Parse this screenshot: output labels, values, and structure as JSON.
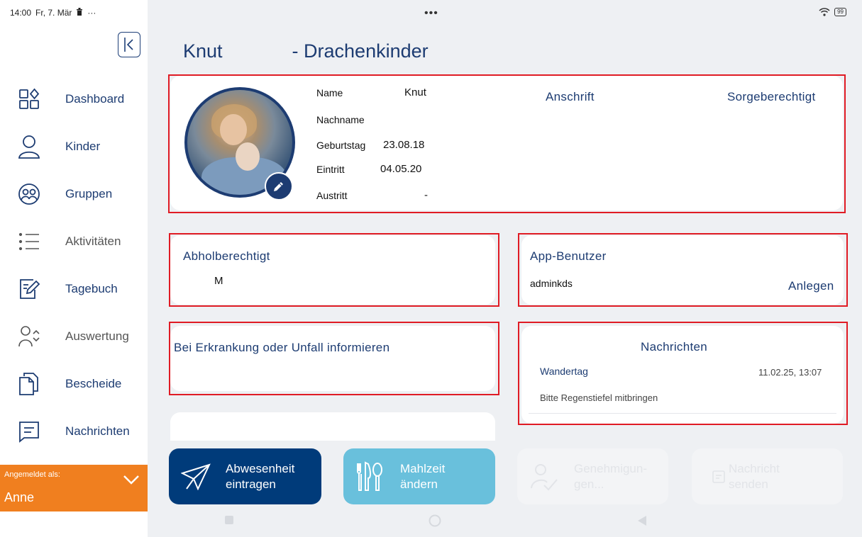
{
  "status_bar": {
    "time": "14:00",
    "date": "Fr, 7. Mär",
    "overflow": "···",
    "center_dots": "•••",
    "battery": "99"
  },
  "sidebar": {
    "items": [
      {
        "label": "Dashboard",
        "icon": "dashboard-icon"
      },
      {
        "label": "Kinder",
        "icon": "person-icon"
      },
      {
        "label": "Gruppen",
        "icon": "group-icon"
      },
      {
        "label": "Aktivitäten",
        "icon": "list-icon"
      },
      {
        "label": "Tagebuch",
        "icon": "diary-edit-icon"
      },
      {
        "label": "Auswertung",
        "icon": "evaluation-icon"
      },
      {
        "label": "Bescheide",
        "icon": "documents-icon"
      },
      {
        "label": "Nachrichten",
        "icon": "message-icon"
      }
    ],
    "login": {
      "caption": "Angemeldet als:",
      "name": "Anne"
    }
  },
  "page": {
    "title_first": "Knut",
    "title_rest": "- Drachenkinder"
  },
  "child_info": {
    "name_label": "Name",
    "name_value": "Knut",
    "lastname_label": "Nachname",
    "lastname_value": "",
    "birthday_label": "Geburtstag",
    "birthday_value": "23.08.18",
    "entry_label": "Eintritt",
    "entry_value": "04.05.20",
    "exit_label": "Austritt",
    "exit_value": "-",
    "address_heading": "Anschrift",
    "guardian_heading": "Sorgeberechtigt"
  },
  "pickup": {
    "title": "Abholberechtigt",
    "person": "M"
  },
  "app_users": {
    "title": "App-Benutzer",
    "user": "adminkds",
    "create_label": "Anlegen"
  },
  "illness": {
    "title": "Bei Erkrankung oder Unfall informieren"
  },
  "messages": {
    "title": "Nachrichten",
    "subject": "Wandertag",
    "timestamp": "11.02.25, 13:07",
    "body": "Bitte Regenstiefel mitbringen"
  },
  "actions": {
    "absence": {
      "line1": "Abwesenheit",
      "line2": "eintragen"
    },
    "meal": {
      "line1": "Mahlzeit",
      "line2": "ändern"
    },
    "permissions": {
      "line1": "Genehmigun-",
      "line2": "gen..."
    },
    "send_message": {
      "line1": "Nachricht",
      "line2": "senden"
    }
  },
  "colors": {
    "primary": "#1d3c72",
    "accent_orange": "#f07f1f",
    "meal_button": "#69c0dc",
    "highlight_red": "#e01b24"
  }
}
